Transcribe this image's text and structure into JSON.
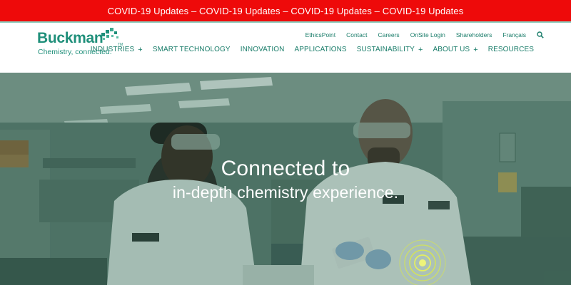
{
  "banner": {
    "text": "COVID-19 Updates – COVID-19 Updates – COVID-19 Updates – COVID-19 Updates",
    "color": "#ee0a0a"
  },
  "brand": {
    "name": "Buckman",
    "tagline": "Chemistry, connected.",
    "trademark": "TM",
    "color": "#1f8f7a"
  },
  "utility_nav": [
    {
      "label": "EthicsPoint"
    },
    {
      "label": "Contact"
    },
    {
      "label": "Careers"
    },
    {
      "label": "OnSite Login"
    },
    {
      "label": "Shareholders"
    },
    {
      "label": "Français"
    }
  ],
  "search": {
    "icon": "search-icon"
  },
  "main_nav": [
    {
      "label": "INDUSTRIES",
      "expandable": "+"
    },
    {
      "label": "SMART TECHNOLOGY"
    },
    {
      "label": "INNOVATION"
    },
    {
      "label": "APPLICATIONS"
    },
    {
      "label": "SUSTAINABILITY",
      "expandable": "+"
    },
    {
      "label": "ABOUT US",
      "expandable": "+"
    },
    {
      "label": "RESOURCES"
    }
  ],
  "hero": {
    "headline": "Connected to",
    "subheadline": "in-depth chemistry experience.",
    "accent": "#d9e84a"
  }
}
